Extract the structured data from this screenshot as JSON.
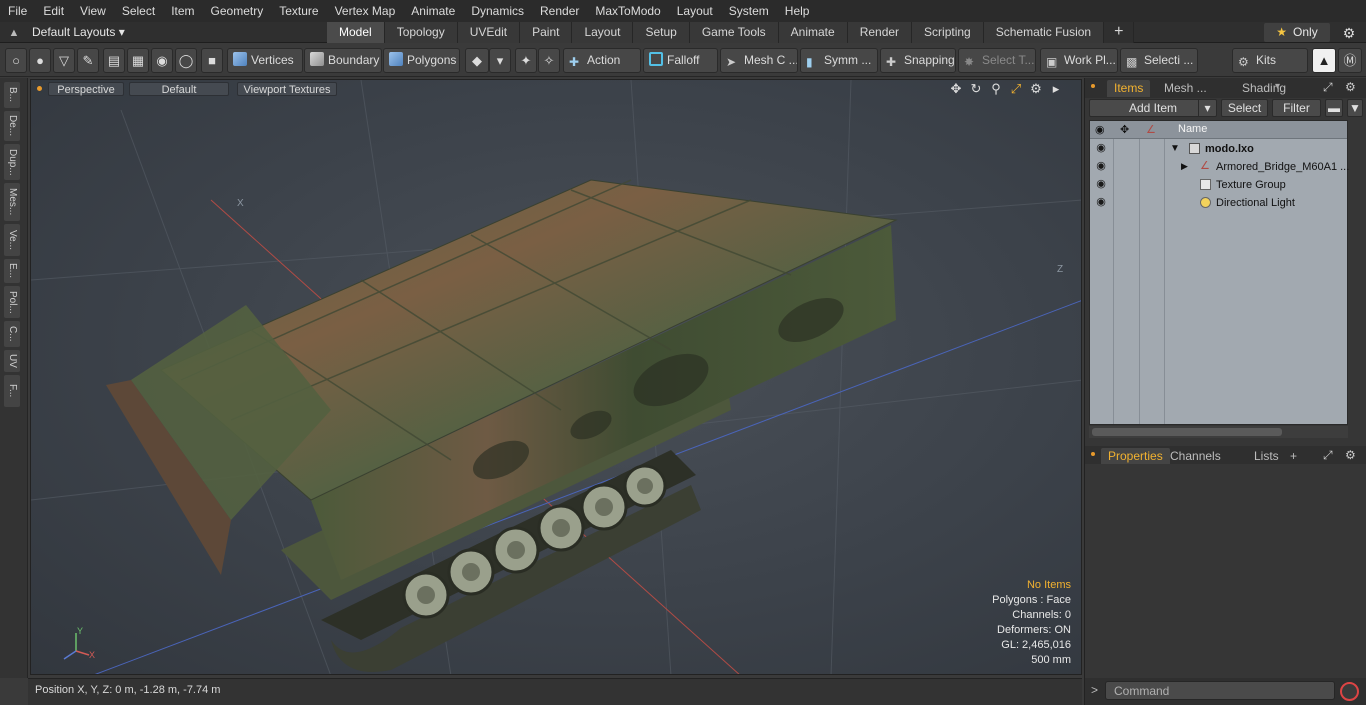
{
  "menu": [
    "File",
    "Edit",
    "View",
    "Select",
    "Item",
    "Geometry",
    "Texture",
    "Vertex Map",
    "Animate",
    "Dynamics",
    "Render",
    "MaxToModo",
    "Layout",
    "System",
    "Help"
  ],
  "layouts": {
    "selected": "Default Layouts ▾"
  },
  "tabs": [
    "Model",
    "Topology",
    "UVEdit",
    "Paint",
    "Layout",
    "Setup",
    "Game Tools",
    "Animate",
    "Render",
    "Scripting",
    "Schematic Fusion"
  ],
  "tab_plus": "+",
  "only_label": "Only",
  "toolbar": {
    "vertices": "Vertices",
    "boundary": "Boundary",
    "polygons": "Polygons",
    "action": "Action",
    "falloff": "Falloff",
    "mesh": "Mesh C ...",
    "symm": "Symm ...",
    "snapping": "Snapping",
    "select_t": "Select T...",
    "work_pl": "Work Pl...",
    "selecti": "Selecti ...",
    "kits": "Kits"
  },
  "left_strip": [
    "B...",
    "De...",
    "Dup...",
    "Mes...",
    "Ve...",
    "E...",
    "Pol...",
    "C...",
    "UV",
    "F..."
  ],
  "viewport": {
    "perspective": "Perspective",
    "shading": "Default",
    "textures": "Viewport Textures",
    "axis_x": "X",
    "axis_z": "Z",
    "gizmo_x": "X",
    "gizmo_y": "Y"
  },
  "stats": {
    "no_items": "No Items",
    "polygons": "Polygons : Face",
    "channels": "Channels: 0",
    "deformers": "Deformers: ON",
    "gl": "GL: 2,465,016",
    "scale": "500 mm"
  },
  "status": {
    "position": "Position X, Y, Z:   0 m, -1.28 m, -7.74 m"
  },
  "items_panel": {
    "tabs": [
      "Items",
      "Mesh ...",
      "Shading"
    ],
    "add_item": "Add Item",
    "select": "Select",
    "filter": "Filter",
    "col_name": "Name",
    "rows": [
      {
        "label": "modo.lxo"
      },
      {
        "label": "Armored_Bridge_M60A1 ..."
      },
      {
        "label": "Texture Group"
      },
      {
        "label": "Directional Light"
      }
    ]
  },
  "props_panel": {
    "tabs": [
      "Properties",
      "Channels",
      "Lists"
    ],
    "plus": "+"
  },
  "command": {
    "placeholder": "Command"
  },
  "colors": {
    "accent": "#f2b230",
    "viewport_bg": "#3c424a",
    "camo_green": "#4c5a3a",
    "camo_brown": "#7a5a3f"
  }
}
